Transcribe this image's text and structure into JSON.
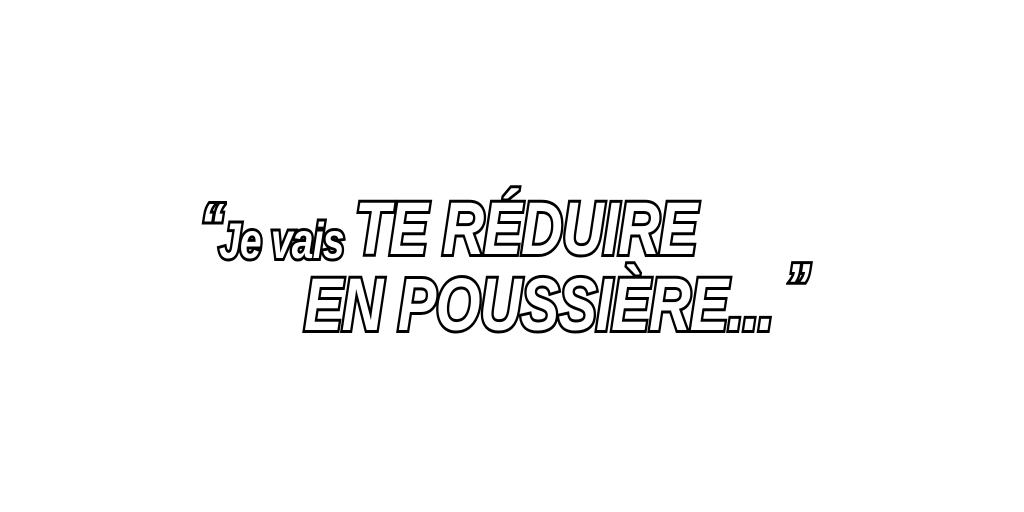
{
  "quote": {
    "open_mark": "“",
    "line1_small": "Je vais",
    "line1_big": "TE RÉDUIRE",
    "line2_big": "EN POUSSIÈRE...",
    "close_mark": "”"
  },
  "colors": {
    "background": "#ffffff",
    "text_fill": "#ffffff",
    "text_outline": "#000000"
  }
}
